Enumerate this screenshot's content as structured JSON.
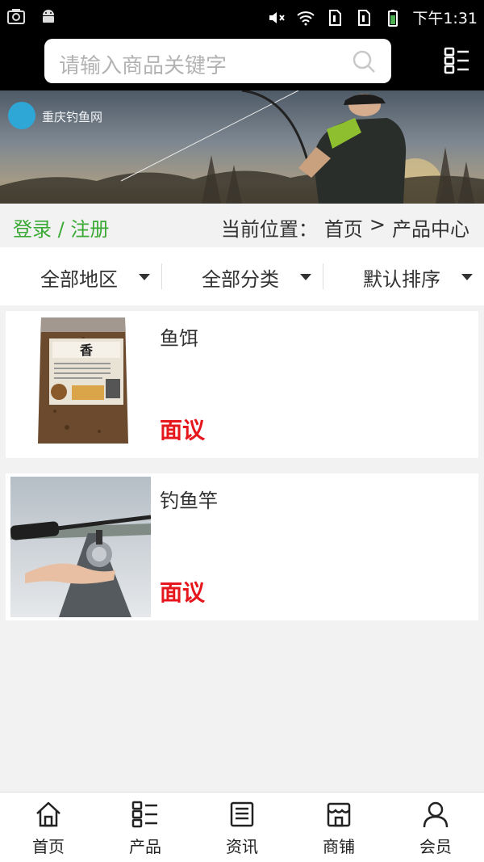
{
  "status_bar": {
    "time": "下午1:31",
    "icons": [
      "camera-icon",
      "android-icon",
      "mute-icon",
      "wifi-icon",
      "sim1-icon",
      "sim2-icon",
      "battery-icon"
    ]
  },
  "search": {
    "placeholder": "请输入商品关键字"
  },
  "banner": {
    "site_name": "重庆钓鱼网"
  },
  "breadcrumb": {
    "login": "登录 / 注册",
    "prefix": "当前位置：",
    "home": "首页",
    "sep": ">",
    "current": "产品中心"
  },
  "filters": [
    {
      "label": "全部地区"
    },
    {
      "label": "全部分类"
    },
    {
      "label": "默认排序"
    }
  ],
  "products": [
    {
      "name": "鱼饵",
      "price": "面议",
      "image": "fish-bait-bag",
      "image_text": "香"
    },
    {
      "name": "钓鱼竿",
      "price": "面议",
      "image": "fishing-rod-reel"
    }
  ],
  "tabs": [
    {
      "label": "首页",
      "icon": "home-icon"
    },
    {
      "label": "产品",
      "icon": "grid-list-icon"
    },
    {
      "label": "资讯",
      "icon": "news-icon"
    },
    {
      "label": "商铺",
      "icon": "shop-icon"
    },
    {
      "label": "会员",
      "icon": "user-icon"
    }
  ],
  "colors": {
    "accent_green": "#3aa935",
    "price_red": "#e5161c",
    "status_bar": "#000000",
    "page_bg": "#f2f2f2"
  }
}
